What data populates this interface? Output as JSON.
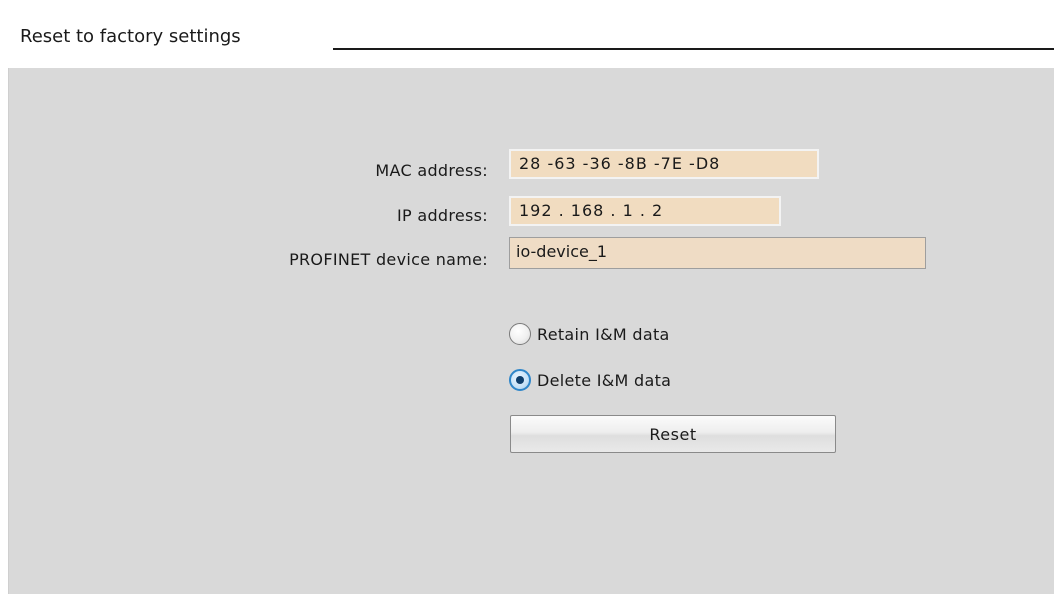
{
  "section": {
    "title": "Reset to factory settings"
  },
  "fields": {
    "mac_label": "MAC address:",
    "mac_value": "28 -63 -36 -8B -7E -D8",
    "ip_label": "IP address:",
    "ip_value": "192 . 168 . 1    . 2",
    "device_name_label": "PROFINET device name:",
    "device_name_value": "io-device_1"
  },
  "options": {
    "retain_label": "Retain I&M data",
    "delete_label": "Delete I&M data",
    "selected": "delete"
  },
  "actions": {
    "reset_label": "Reset"
  },
  "colors": {
    "panel_background": "#d9d9d9",
    "field_background": "#f1dcc0",
    "radio_selected": "#2f86c9"
  }
}
